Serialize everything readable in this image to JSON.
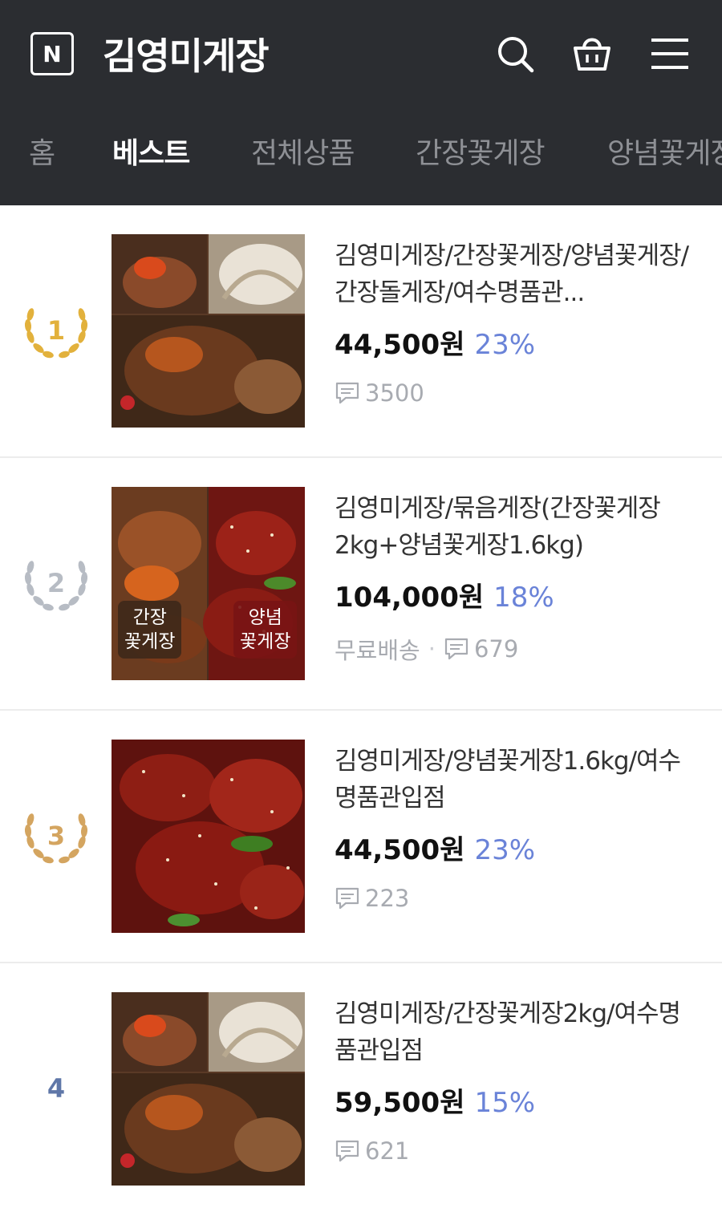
{
  "header": {
    "logo": "N",
    "store_name": "김영미게장",
    "icons": [
      "search-icon",
      "cart-icon",
      "menu-icon"
    ]
  },
  "tabs": [
    {
      "label": "홈",
      "active": false
    },
    {
      "label": "베스트",
      "active": true
    },
    {
      "label": "전체상품",
      "active": false
    },
    {
      "label": "간장꽃게장",
      "active": false
    },
    {
      "label": "양념꽃게장",
      "active": false
    }
  ],
  "colors": {
    "header_bg": "#2b2d31",
    "discount": "#6a83d8",
    "rank_gold": "#e2b13c",
    "rank_silver": "#b7bcc4",
    "rank_bronze": "#d4a560",
    "rank_plain": "#5f77a8"
  },
  "products": [
    {
      "rank": "1",
      "title": "김영미게장/간장꽃게장/양념꽃게장/간장돌게장/여수명품관...",
      "price": "44,500원",
      "discount": "23%",
      "shipping": "",
      "reviews": "3500"
    },
    {
      "rank": "2",
      "title": "김영미게장/묶음게장(간장꽃게장2kg+양념꽃게장1.6kg)",
      "price": "104,000원",
      "discount": "18%",
      "shipping": "무료배송",
      "reviews": "679",
      "image_labels": [
        "간장\n꽃게장",
        "양념\n꽃게장"
      ]
    },
    {
      "rank": "3",
      "title": "김영미게장/양념꽃게장1.6kg/여수명품관입점",
      "price": "44,500원",
      "discount": "23%",
      "shipping": "",
      "reviews": "223"
    },
    {
      "rank": "4",
      "title": "김영미게장/간장꽃게장2kg/여수명품관입점",
      "price": "59,500원",
      "discount": "15%",
      "shipping": "",
      "reviews": "621"
    }
  ]
}
